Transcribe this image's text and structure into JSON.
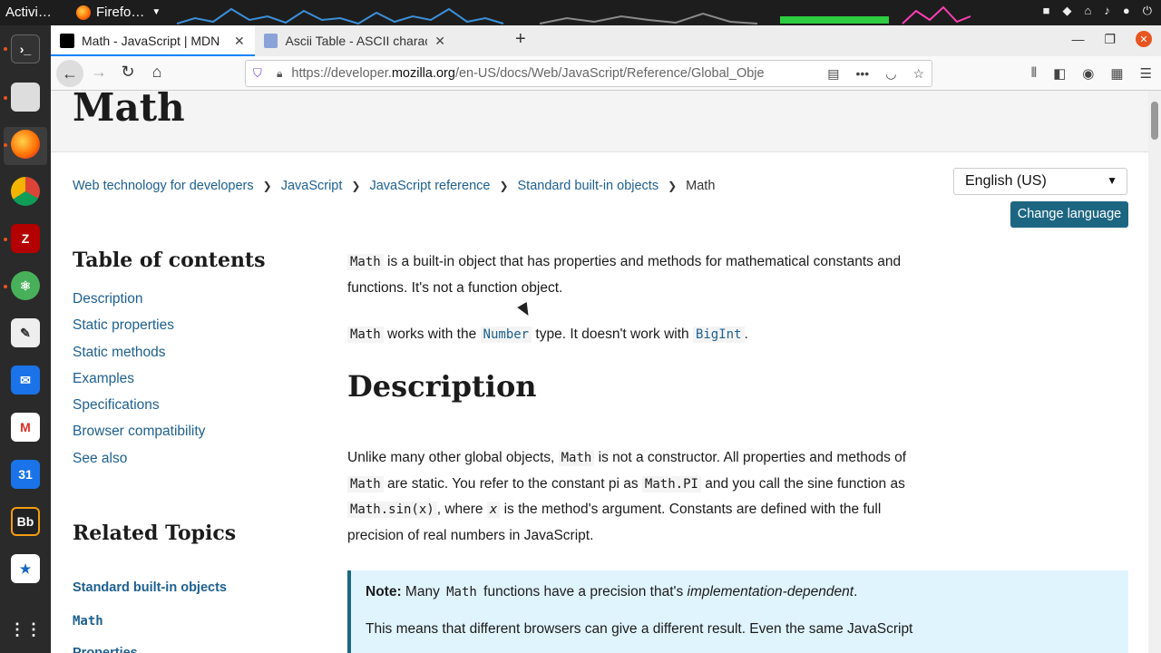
{
  "system_bar": {
    "activities": "Activi…",
    "app_name": "Firefo…"
  },
  "browser": {
    "tabs": [
      {
        "title": "Math - JavaScript | MDN",
        "active": true
      },
      {
        "title": "Ascii Table - ASCII charac",
        "active": false
      }
    ],
    "url_prefix": "https://developer.",
    "url_domain": "mozilla.org",
    "url_path": "/en-US/docs/Web/JavaScript/Reference/Global_Obje"
  },
  "page": {
    "title": "Math",
    "breadcrumbs": [
      "Web technology for developers",
      "JavaScript",
      "JavaScript reference",
      "Standard built-in objects"
    ],
    "breadcrumb_current": "Math",
    "language_value": "English (US)",
    "change_language": "Change language",
    "toc_heading": "Table of contents",
    "toc": [
      "Description",
      "Static properties",
      "Static methods",
      "Examples",
      "Specifications",
      "Browser compatibility",
      "See also"
    ],
    "related_heading": "Related Topics",
    "related_1": "Standard built-in objects",
    "related_2": "Math",
    "related_3": "Properties",
    "intro": {
      "code": "Math",
      "text": " is a built-in object that has properties and methods for mathematical constants and functions. It's not a function object."
    },
    "works": {
      "code1": "Math",
      "t1": " works with the ",
      "code2": "Number",
      "t2": " type. It doesn't work with ",
      "code3": "BigInt",
      "t3": "."
    },
    "description_heading": "Description",
    "desc": {
      "t1": "Unlike many other global objects, ",
      "c1": "Math",
      "t2": " is not a constructor. All properties and methods of ",
      "c2": "Math",
      "t3": " are static. You refer to the constant pi as ",
      "c3": "Math.PI",
      "t4": " and you call the sine function as ",
      "c4": "Math.sin(x)",
      "t5": ", where ",
      "c5": "x",
      "t6": " is the method's argument. Constants are defined with the full precision of real numbers in JavaScript."
    },
    "note": {
      "label": "Note:",
      "t1": " Many ",
      "code": "Math",
      "t2": " functions have a precision that's ",
      "em": "implementation-dependent",
      "t3": ".",
      "second": "This means that different browsers can give a different result. Even the same JavaScript"
    }
  }
}
